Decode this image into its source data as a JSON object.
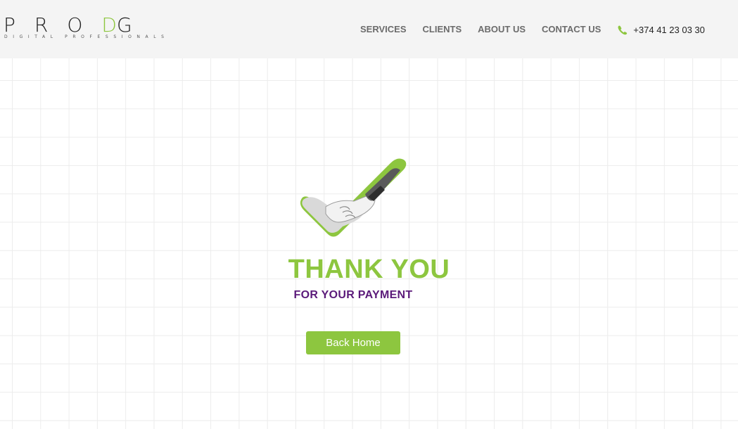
{
  "logo": {
    "letters": "PRO",
    "accent": "D",
    "rest": "G",
    "subtitle": "DIGITAL PROFESSIONALS"
  },
  "nav": {
    "items": [
      {
        "label": "SERVICES"
      },
      {
        "label": "CLIENTS"
      },
      {
        "label": "ABOUT US"
      },
      {
        "label": "CONTACT US"
      }
    ],
    "phone": {
      "icon": "phone-icon",
      "number": "+374 41 23 03 30"
    }
  },
  "main": {
    "graphic": "handshake-checkmark-icon",
    "title": "THANK YOU",
    "subtitle": "FOR YOUR PAYMENT",
    "button_label": "Back Home"
  },
  "colors": {
    "accent": "#8dc63f",
    "subtitle": "#5b1a7a",
    "header_bg": "#f4f4f4",
    "nav_text": "#6b6b6b"
  }
}
